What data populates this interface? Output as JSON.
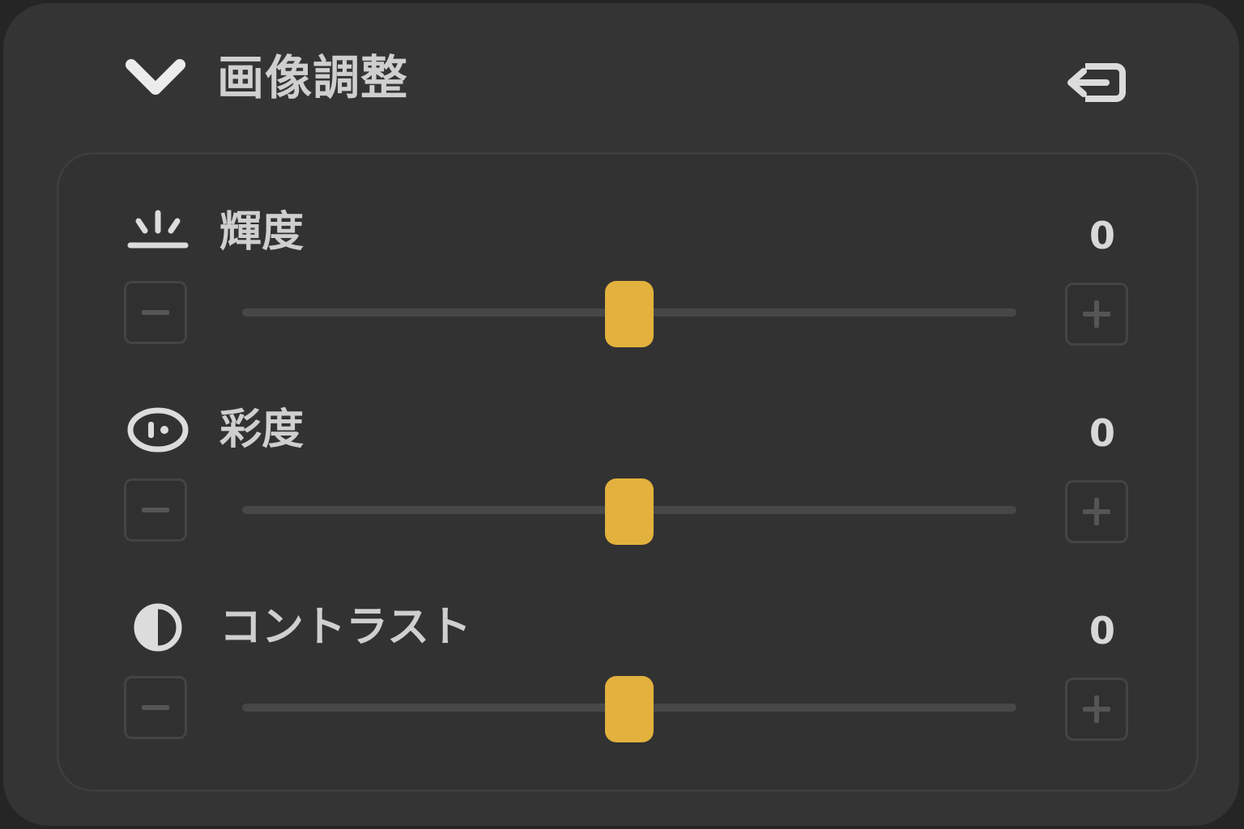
{
  "panel": {
    "title": "画像調整",
    "accent_color": "#e2b13e"
  },
  "controls": [
    {
      "key": "brightness",
      "label": "輝度",
      "value": "0",
      "icon": "brightness-icon",
      "slider_fraction": 0.5
    },
    {
      "key": "saturation",
      "label": "彩度",
      "value": "0",
      "icon": "saturation-icon",
      "slider_fraction": 0.5
    },
    {
      "key": "contrast",
      "label": "コントラスト",
      "value": "0",
      "icon": "contrast-icon",
      "slider_fraction": 0.5
    }
  ]
}
